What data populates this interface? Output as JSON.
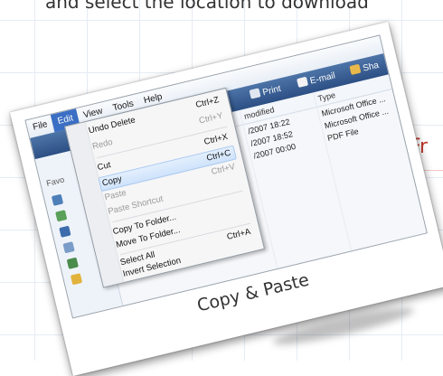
{
  "slide": {
    "top_text": "and select the location to download",
    "side_text": "Fr"
  },
  "caption": "Copy & Paste",
  "menubar": [
    "File",
    "Edit",
    "View",
    "Tools",
    "Help"
  ],
  "toolbar": {
    "print": "Print",
    "email": "E-mail",
    "share": "Sha"
  },
  "columns": {
    "modified": "modified",
    "type": "Type"
  },
  "nav": {
    "favorites": "Favo"
  },
  "files": [
    {
      "date": "/2007 18:22",
      "type": "Microsoft Office ..."
    },
    {
      "date": "/2007 18:52",
      "type": "Microsoft Office ..."
    },
    {
      "date": "/2007 00:00",
      "type": "PDF File"
    }
  ],
  "context_menu": {
    "undo": {
      "label": "Undo Delete",
      "shortcut": "Ctrl+Z"
    },
    "redo": {
      "label": "Redo",
      "shortcut": "Ctrl+Y"
    },
    "cut": {
      "label": "Cut",
      "shortcut": "Ctrl+X"
    },
    "copy": {
      "label": "Copy",
      "shortcut": "Ctrl+C"
    },
    "paste": {
      "label": "Paste",
      "shortcut": "Ctrl+V"
    },
    "paste_shortcut": {
      "label": "Paste Shortcut"
    },
    "copy_to": {
      "label": "Copy To Folder..."
    },
    "move_to": {
      "label": "Move To Folder..."
    },
    "select_all": {
      "label": "Select All",
      "shortcut": "Ctrl+A"
    },
    "invert": {
      "label": "Invert Selection"
    }
  },
  "colors": {
    "menu_highlight": "#3b6fc4",
    "toolbar": "#2c4f84",
    "accent_red": "#c0392b"
  }
}
